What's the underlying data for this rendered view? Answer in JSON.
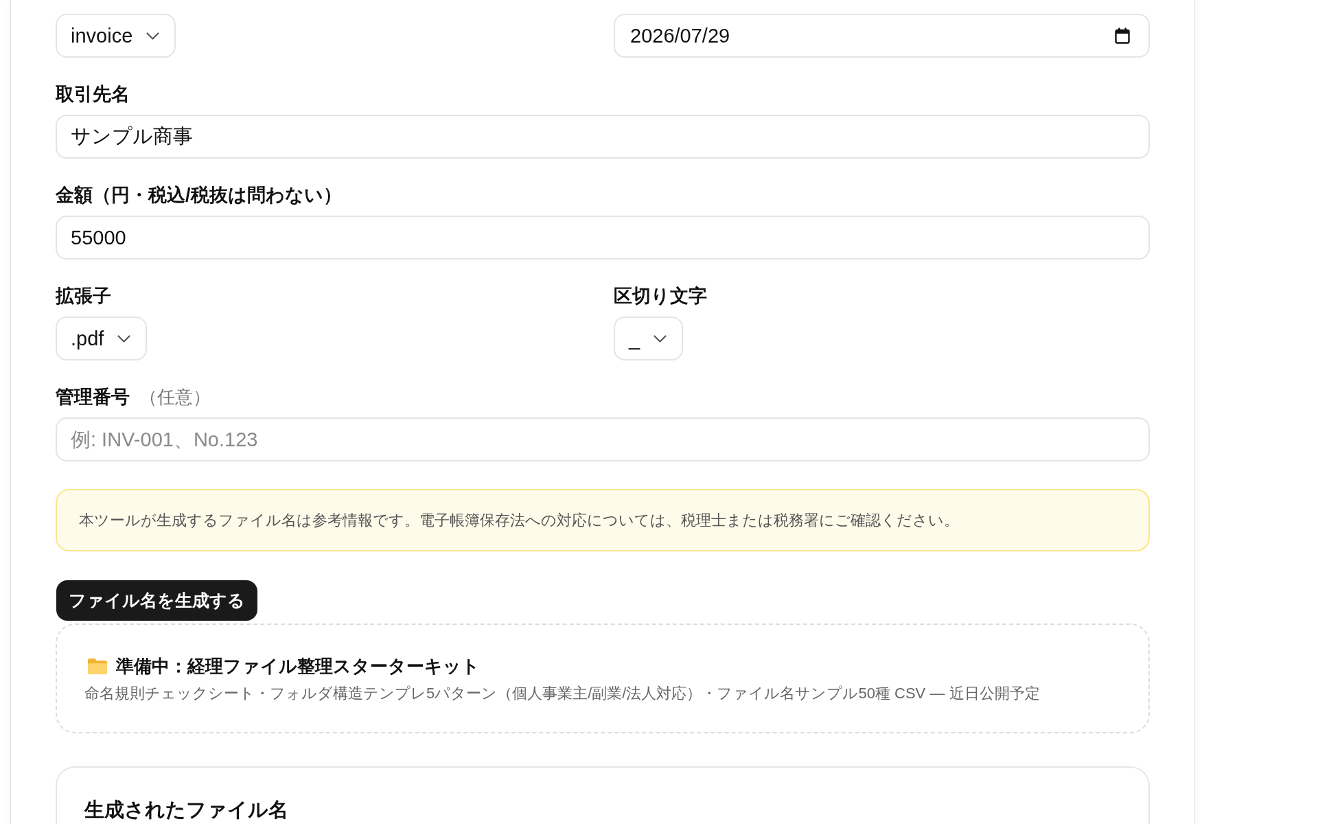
{
  "rows": [
    {
      "fields": [
        {
          "kind": "select",
          "value": "invoice"
        },
        {
          "kind": "date",
          "value": "2026/07/29"
        }
      ]
    },
    {
      "fields": [
        {
          "kind": "text",
          "label": "取引先名",
          "value": "サンプル商事"
        }
      ]
    },
    {
      "fields": [
        {
          "kind": "text",
          "label": "金額（円・税込/税抜は問わない）",
          "value": "55000"
        }
      ]
    },
    {
      "fields": [
        {
          "kind": "select",
          "label": "拡張子",
          "value": ".pdf"
        },
        {
          "kind": "select",
          "label": "区切り文字",
          "value": "_"
        }
      ]
    },
    {
      "fields": [
        {
          "kind": "text",
          "label": "管理番号",
          "note": "（任意）",
          "placeholder": "例: INV-001、No.123"
        }
      ]
    }
  ],
  "notice": {
    "text": "本ツールが生成するファイル名は参考情報です。電子帳簿保存法への対応については、税理士または税務署にご確認ください。"
  },
  "generate_button": {
    "label": "ファイル名を生成する"
  },
  "coming_soon": {
    "title": "準備中：経理ファイル整理スターターキット",
    "description": "命名規則チェックシート・フォルダ構造テンプレ5パターン（個人事業主/副業/法人対応）・ファイル名サンプル50種 CSV — 近日公開予定"
  },
  "result": {
    "heading": "生成されたファイル名"
  }
}
